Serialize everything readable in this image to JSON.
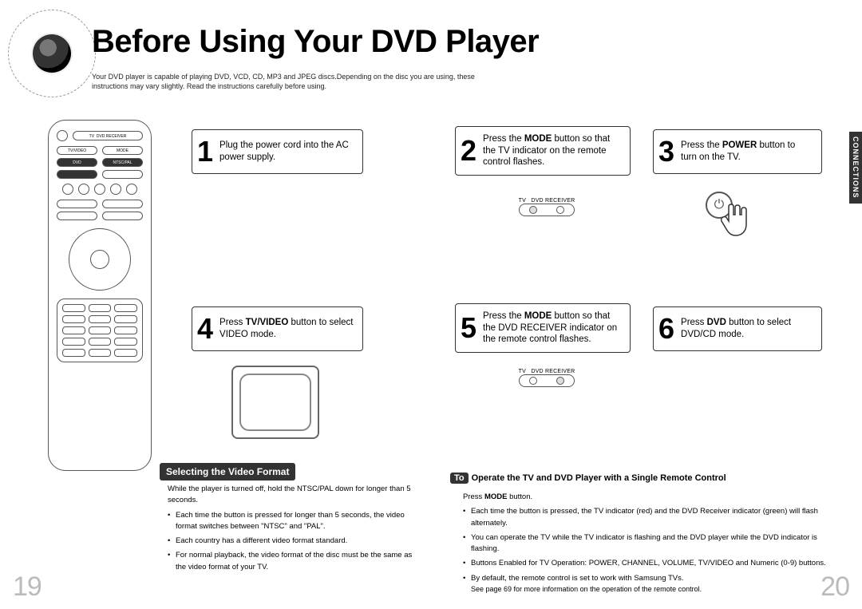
{
  "title": "Before Using Your DVD Player",
  "intro": "Your DVD player is capable of playing DVD, VCD, CD, MP3 and JPEG discs.Depending on the disc you are using, these instructions may vary slightly. Read the instructions carefully before using.",
  "side_tab": "CONNECTIONS",
  "steps": {
    "s1": {
      "num": "1",
      "text_pre": "Plug the power cord into the AC power supply."
    },
    "s2": {
      "num": "2",
      "text": "Press the MODE button so that the TV indicator on the remote control flashes."
    },
    "s3": {
      "num": "3",
      "text": "Press the POWER button to turn on the TV."
    },
    "s4": {
      "num": "4",
      "text": "Press TV/VIDEO button to select VIDEO mode."
    },
    "s5": {
      "num": "5",
      "text": "Press the MODE button so that the DVD RECEIVER indicator on the remote control flashes."
    },
    "s6": {
      "num": "6",
      "text": "Press DVD button to select DVD/CD mode."
    }
  },
  "switch_labels": {
    "tv": "TV",
    "dvd": "DVD RECEIVER"
  },
  "section_a": {
    "heading": "Selecting the Video Format",
    "lead": "While the player is turned off, hold the NTSC/PAL down for longer than 5 seconds.",
    "bullets": [
      "Each time the button is pressed for longer than 5 seconds, the video format switches between \"NTSC\" and \"PAL\".",
      "Each country has a different video format standard.",
      "For normal playback, the video format of the disc must be the same as the video format of your TV."
    ]
  },
  "section_b": {
    "to": "To",
    "heading_rest": "Operate the TV and DVD Player with a Single Remote Control",
    "lead": "Press MODE button.",
    "bullets": [
      "Each time the button is pressed, the TV indicator (red) and the DVD Receiver indicator (green) will flash alternately.",
      "You can operate the TV while the TV indicator is flashing and the DVD player while the DVD indicator is flashing.",
      "Buttons Enabled for TV Operation: POWER, CHANNEL, VOLUME, TV/VIDEO and Numeric (0-9) buttons.",
      "By default, the remote control is set to work with Samsung TVs."
    ],
    "subnote": "See page 69 for more information on the operation of the remote control."
  },
  "page_left": "19",
  "page_right": "20",
  "remote_labels": {
    "tv": "TV",
    "dvdrec": "DVD RECEIVER",
    "tvvideo": "TV/VIDEO",
    "mode": "MODE",
    "dvd": "DVD",
    "ntscpal": "NTSC/PAL"
  }
}
